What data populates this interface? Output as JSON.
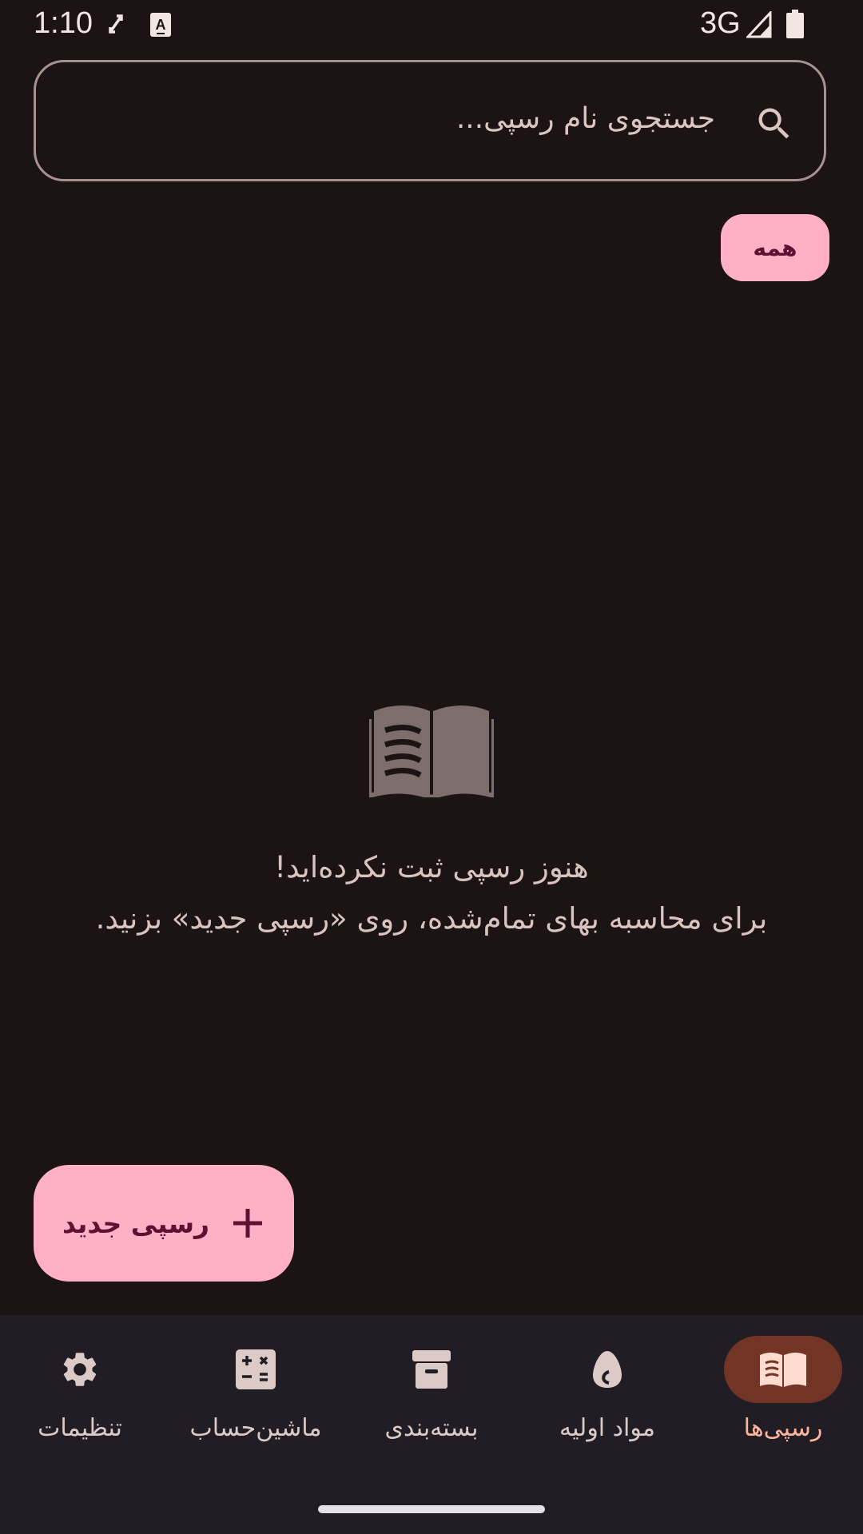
{
  "status_bar": {
    "time": "1:10",
    "network": "3G",
    "icons": [
      "screen-rotate-icon",
      "keyboard-a-icon",
      "signal-icon",
      "battery-icon"
    ]
  },
  "search": {
    "placeholder": "جستجوی نام رسپی...",
    "icon": "search-icon"
  },
  "filter_chips": [
    {
      "label": "همه",
      "selected": true
    }
  ],
  "empty_state": {
    "icon": "open-book-icon",
    "title": "هنوز رسپی ثبت نکرده‌اید!",
    "description": "برای محاسبه بهای تمام‌شده، روی «رسپی جدید» بزنید."
  },
  "fab": {
    "label": "رسپی جدید",
    "icon": "plus-icon"
  },
  "bottom_nav": {
    "items": [
      {
        "label": "رسپی‌ها",
        "icon": "recipe-book-icon",
        "active": true
      },
      {
        "label": "مواد اولیه",
        "icon": "egg-icon",
        "active": false
      },
      {
        "label": "بسته‌بندی",
        "icon": "package-icon",
        "active": false
      },
      {
        "label": "ماشین‌حساب",
        "icon": "calculator-icon",
        "active": false
      },
      {
        "label": "تنظیمات",
        "icon": "gear-icon",
        "active": false
      }
    ]
  },
  "colors": {
    "background": "#1c1414",
    "accent": "#ffb0c4",
    "on_accent": "#5e1133",
    "nav_background": "#201e24",
    "nav_active_indicator": "#723425",
    "nav_active_label": "#ffb49c"
  }
}
